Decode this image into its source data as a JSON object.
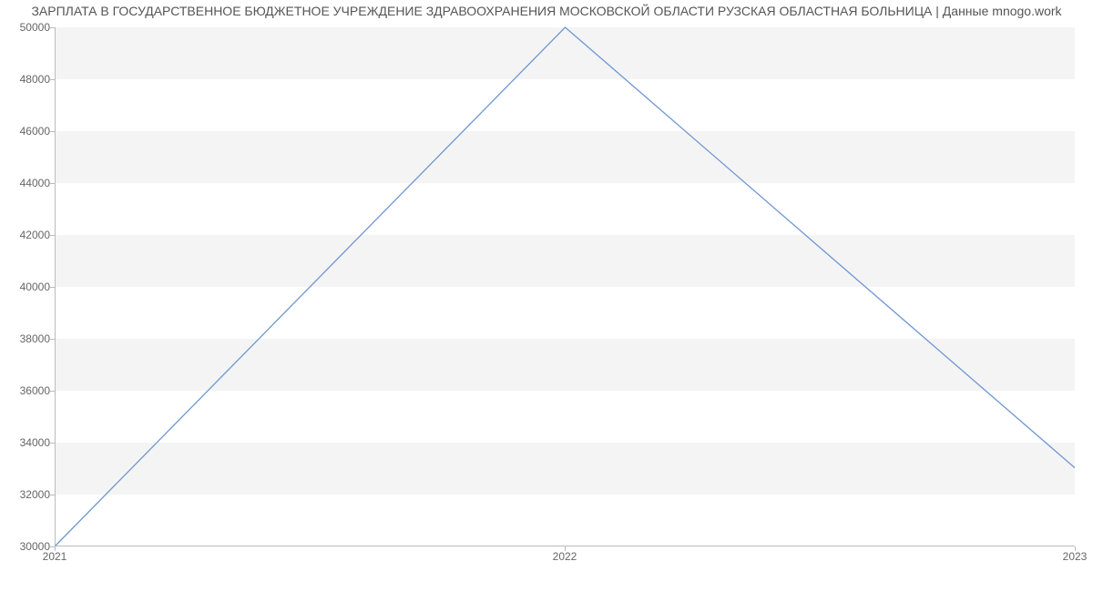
{
  "chart_data": {
    "type": "line",
    "title": "ЗАРПЛАТА В ГОСУДАРСТВЕННОЕ БЮДЖЕТНОЕ УЧРЕЖДЕНИЕ ЗДРАВООХРАНЕНИЯ МОСКОВСКОЙ ОБЛАСТИ РУЗСКАЯ ОБЛАСТНАЯ БОЛЬНИЦА | Данные mnogo.work",
    "x": [
      2021,
      2022,
      2023
    ],
    "values": [
      30000,
      50000,
      33000
    ],
    "x_ticks": [
      2021,
      2022,
      2023
    ],
    "y_ticks": [
      30000,
      32000,
      34000,
      36000,
      38000,
      40000,
      42000,
      44000,
      46000,
      48000,
      50000
    ],
    "ylim": [
      30000,
      50000
    ],
    "xlim": [
      2021,
      2023
    ],
    "xlabel": "",
    "ylabel": "",
    "line_color": "#6f97d2",
    "grid_band_color": "#f4f4f4"
  }
}
